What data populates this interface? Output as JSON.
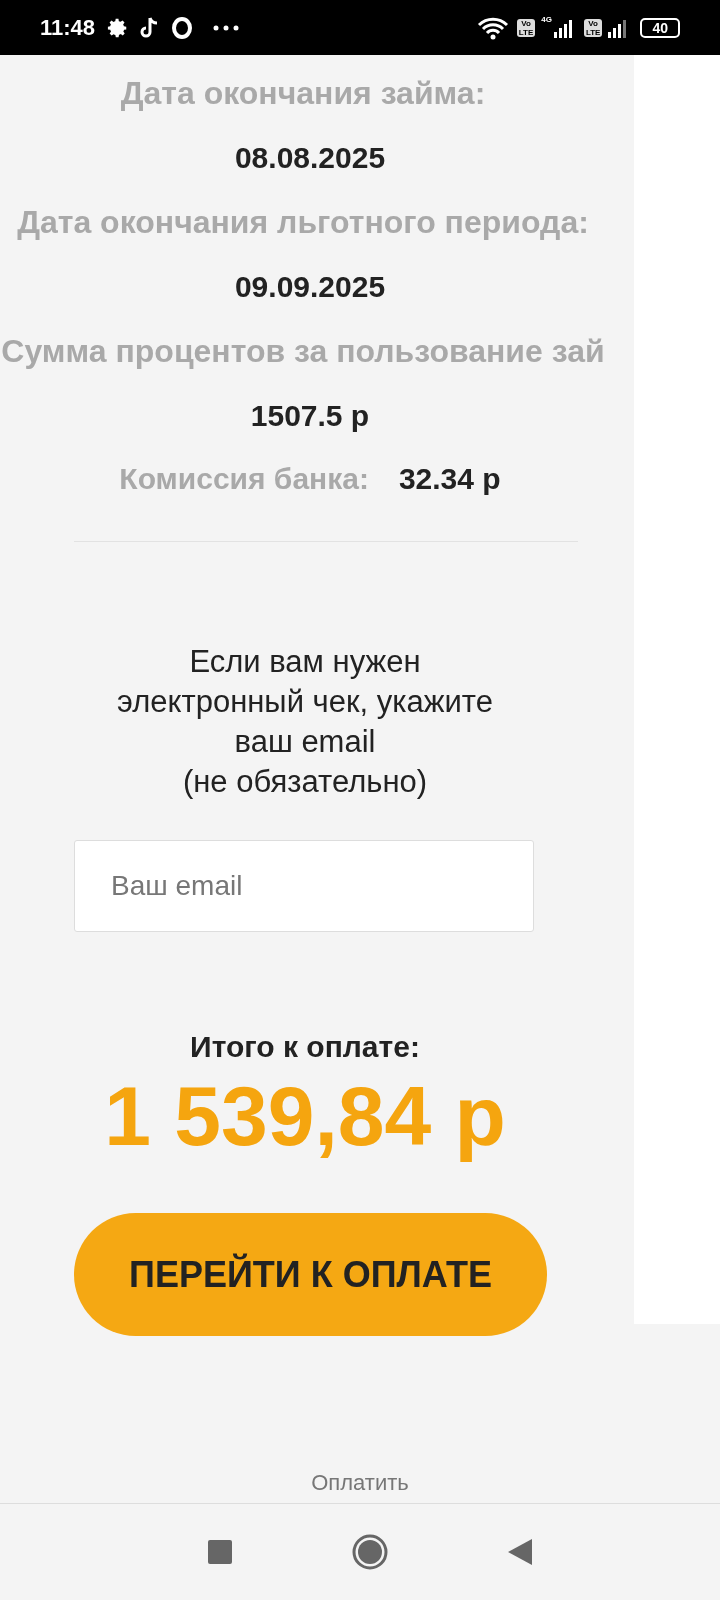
{
  "status_bar": {
    "time": "11:48",
    "battery": "40",
    "network": "4G",
    "volte": [
      "Vo\nLTE",
      "Vo\nLTE"
    ]
  },
  "loan": [
    {
      "kind": "stacked",
      "label": "Дата окончания займа:",
      "value": "08.08.2025"
    },
    {
      "kind": "stacked",
      "label": "Дата окончания льготного периода:",
      "value": "09.09.2025"
    },
    {
      "kind": "stacked",
      "label": "Сумма процентов за пользование зай",
      "value": "1507.5 р"
    },
    {
      "kind": "inline",
      "label": "Комиссия банка:",
      "value": "32.34 р"
    }
  ],
  "receipt": {
    "text_lines": [
      "Если вам нужен",
      "электронный чек, укажите",
      "ваш email",
      "(не обязательно)"
    ],
    "email_placeholder": "Ваш email"
  },
  "total": {
    "label": "Итого к оплате:",
    "amount": "1 539,84 р"
  },
  "pay_button": "ПЕРЕЙТИ К ОПЛАТЕ",
  "page_title": "Оплатить"
}
